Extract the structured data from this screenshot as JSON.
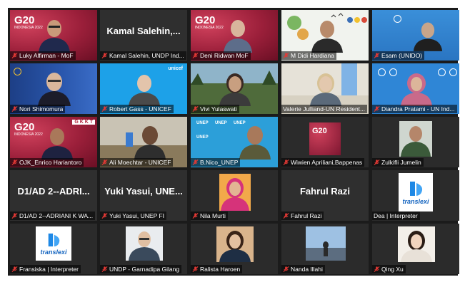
{
  "meeting": {
    "participants": [
      {
        "id": "p1",
        "name": "Luky Alfirman - MoF",
        "big_name": "",
        "active": true,
        "muted": true
      },
      {
        "id": "p2",
        "name": "Kamal Salehin, UNDP Ind...",
        "big_name": "Kamal Salehin,...",
        "active": false,
        "muted": true
      },
      {
        "id": "p3",
        "name": "Deni Ridwan MoF",
        "big_name": "",
        "active": false,
        "muted": true
      },
      {
        "id": "p4",
        "name": "M Didi Hardiana",
        "big_name": "",
        "active": false,
        "muted": true
      },
      {
        "id": "p5",
        "name": "Esam (UNIDO)",
        "big_name": "",
        "active": false,
        "muted": true
      },
      {
        "id": "p6",
        "name": "Nori Shimomura",
        "big_name": "",
        "active": false,
        "muted": true
      },
      {
        "id": "p7",
        "name": "Robert Gass - UNICEF",
        "big_name": "",
        "active": false,
        "muted": true
      },
      {
        "id": "p8",
        "name": "Vivi Yulaswati",
        "big_name": "",
        "active": false,
        "muted": true
      },
      {
        "id": "p9",
        "name": "Valerie Julliand-UN Resident...",
        "big_name": "",
        "active": false,
        "muted": false
      },
      {
        "id": "p10",
        "name": "Diandra Pratami - UN Ind...",
        "big_name": "",
        "active": false,
        "muted": true
      },
      {
        "id": "p11",
        "name": "OJK_Enrico Hariantoro",
        "big_name": "",
        "active": false,
        "muted": true
      },
      {
        "id": "p12",
        "name": "Ali Moechtar - UNICEF",
        "big_name": "",
        "active": false,
        "muted": true
      },
      {
        "id": "p13",
        "name": "B.Nico_UNEP",
        "big_name": "",
        "active": false,
        "muted": true
      },
      {
        "id": "p14",
        "name": "Wiwien Apriliani,Bappenas",
        "big_name": "",
        "active": false,
        "muted": true
      },
      {
        "id": "p15",
        "name": "Zulkifli Jumelin",
        "big_name": "",
        "active": false,
        "muted": true
      },
      {
        "id": "p16",
        "name": "D1/AD 2--ADRIANI K WA...",
        "big_name": "D1/AD 2--ADRI...",
        "active": false,
        "muted": true
      },
      {
        "id": "p17",
        "name": "Yuki Yasui, UNEP FI",
        "big_name": "Yuki Yasui, UNE...",
        "active": false,
        "muted": true
      },
      {
        "id": "p18",
        "name": "Nila Murti",
        "big_name": "",
        "active": false,
        "muted": true
      },
      {
        "id": "p19",
        "name": "Fahrul Razi",
        "big_name": "Fahrul Razi",
        "active": false,
        "muted": true
      },
      {
        "id": "p20",
        "name": "Dea | Interpreter",
        "big_name": "",
        "active": false,
        "muted": false
      },
      {
        "id": "p21",
        "name": "Fransiska | Interpreter",
        "big_name": "",
        "active": false,
        "muted": true
      },
      {
        "id": "p22",
        "name": "UNDP - Garnadipa Gilang",
        "big_name": "",
        "active": false,
        "muted": true
      },
      {
        "id": "p23",
        "name": "Ralista Haroen",
        "big_name": "",
        "active": false,
        "muted": true
      },
      {
        "id": "p24",
        "name": "Nanda Illahi",
        "big_name": "",
        "active": false,
        "muted": true
      },
      {
        "id": "p25",
        "name": "Qing Xu",
        "big_name": "",
        "active": false,
        "muted": true
      }
    ]
  },
  "branding": {
    "g20_label": "G20",
    "g20_sub": "INDONESIA 2022",
    "unicef_label": "unicef",
    "translexi_label": "translexi",
    "gkkt_label": "G K K T",
    "unep_label": "UNEP"
  },
  "colors": {
    "stage": "#1b1b1b",
    "active_border": "#e6d21e",
    "muted_icon": "#e53935",
    "g20_red": "#b0243d",
    "unicef_blue": "#1da1e8",
    "un_blue": "#2f86d6"
  }
}
